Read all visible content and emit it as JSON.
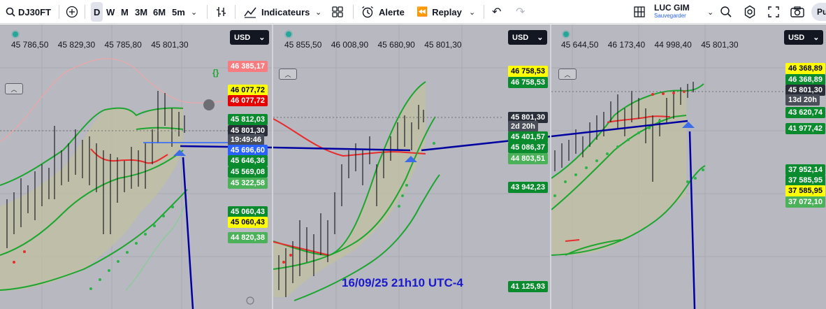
{
  "toolbar": {
    "symbol": "DJ30FT",
    "timeframes": [
      "D",
      "W",
      "M",
      "3M",
      "6M",
      "5m"
    ],
    "selected_timeframe": "D",
    "indicators_label": "Indicateurs",
    "alert_label": "Alerte",
    "replay_label": "Replay",
    "layout_name": "LUC GIM",
    "layout_status": "Sauvegarder",
    "publish_label": "Pu"
  },
  "colors": {
    "accent": "#2962ff",
    "green": "#089981",
    "red": "#f23645",
    "yellow": "#ffff00",
    "drawing": "#0000a0",
    "annotation": "#1a1acc"
  },
  "pane1": {
    "ohlc": [
      "45 786,50",
      "45 829,30",
      "45 785,80",
      "45 801,30"
    ],
    "currency": "USD",
    "price_labels": [
      {
        "text": "46 385,17",
        "style": "light-red"
      },
      {
        "text": "46 077,72",
        "style": "yellow"
      },
      {
        "text": "46 077,72",
        "style": "red"
      },
      {
        "text": "45 812,03",
        "style": "green"
      },
      {
        "text": "45 801,30",
        "style": "dark"
      },
      {
        "text": "19:49:46",
        "style": "dark-sub"
      },
      {
        "text": "45 696,60",
        "style": "blue"
      },
      {
        "text": "45 646,36",
        "style": "green"
      },
      {
        "text": "45 569,08",
        "style": "green"
      },
      {
        "text": "45 322,58",
        "style": "light-green"
      },
      {
        "text": "45 060,43",
        "style": "green"
      },
      {
        "text": "45 060,43",
        "style": "yellow"
      },
      {
        "text": "44 820,38",
        "style": "light-green"
      }
    ]
  },
  "pane2": {
    "ohlc": [
      "45 855,50",
      "46 008,90",
      "45 680,90",
      "45 801,30"
    ],
    "currency": "USD",
    "price_labels": [
      {
        "text": "46 758,53",
        "style": "yellow"
      },
      {
        "text": "46 758,53",
        "style": "green"
      },
      {
        "text": "45 801,30",
        "style": "dark"
      },
      {
        "text": "2d 20h",
        "style": "dark-sub"
      },
      {
        "text": "45 401,57",
        "style": "green"
      },
      {
        "text": "45 086,37",
        "style": "green"
      },
      {
        "text": "44 803,51",
        "style": "light-green"
      },
      {
        "text": "43 942,23",
        "style": "green"
      },
      {
        "text": "41 125,93",
        "style": "green"
      }
    ],
    "annotation": "16/09/25 21h10 UTC-4"
  },
  "pane3": {
    "ohlc": [
      "45 644,50",
      "46 173,40",
      "44 998,40",
      "45 801,30"
    ],
    "currency": "USD",
    "price_labels": [
      {
        "text": "46 368,89",
        "style": "yellow"
      },
      {
        "text": "46 368,89",
        "style": "green"
      },
      {
        "text": "45 801,30",
        "style": "dark"
      },
      {
        "text": "13d 20h",
        "style": "dark-sub"
      },
      {
        "text": "43 620,74",
        "style": "green"
      },
      {
        "text": "41 977,42",
        "style": "green"
      },
      {
        "text": "37 952,14",
        "style": "green"
      },
      {
        "text": "37 585,95",
        "style": "green"
      },
      {
        "text": "37 585,95",
        "style": "yellow"
      },
      {
        "text": "37 072,10",
        "style": "light-green"
      }
    ]
  }
}
